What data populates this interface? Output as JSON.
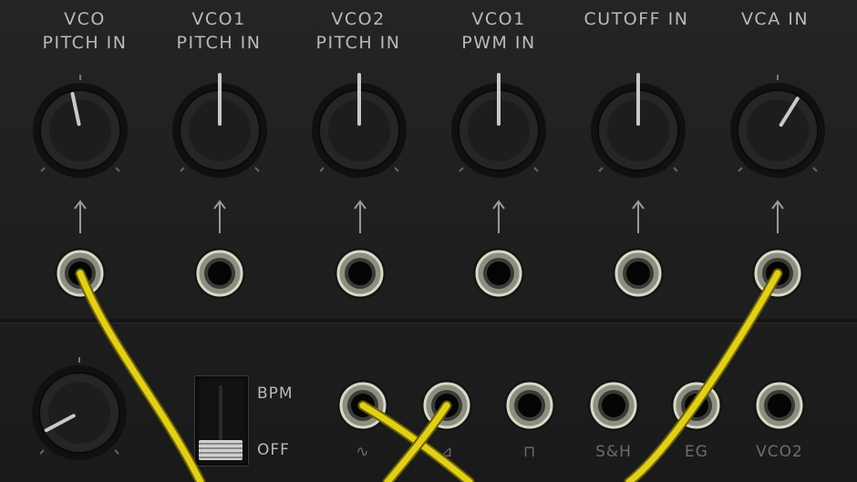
{
  "top_labels": [
    {
      "line1": "VCO",
      "line2": "PITCH IN"
    },
    {
      "line1": "VCO1",
      "line2": "PITCH IN"
    },
    {
      "line1": "VCO2",
      "line2": "PITCH IN"
    },
    {
      "line1": "VCO1",
      "line2": "PWM IN"
    },
    {
      "line1": "",
      "line2": "CUTOFF IN"
    },
    {
      "line1": "",
      "line2": "VCA IN"
    }
  ],
  "sync_switch": {
    "top_label": "BPM",
    "bottom_label": "OFF",
    "position": "OFF"
  },
  "output_labels": [
    "∿",
    "⊿",
    "⊓",
    "S&H",
    "EG",
    "VCO2"
  ],
  "colors": {
    "cable": "#e2cf1a",
    "panel": "#1e1e1e",
    "label": "#b9b9b9"
  }
}
